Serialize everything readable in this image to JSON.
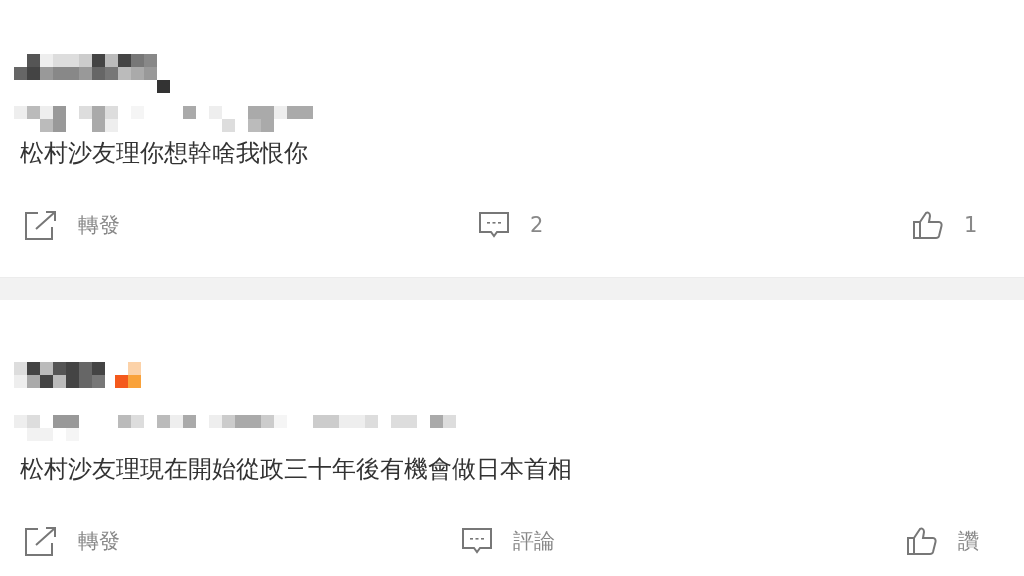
{
  "posts": [
    {
      "has_badge": false,
      "text": "松村沙友理你想幹啥我恨你",
      "actions": [
        {
          "kind": "share",
          "label": "轉發"
        },
        {
          "kind": "comment",
          "label": "2"
        },
        {
          "kind": "like",
          "label": "1"
        }
      ]
    },
    {
      "has_badge": true,
      "text": "松村沙友理現在開始從政三十年後有機會做日本首相",
      "actions": [
        {
          "kind": "share",
          "label": "轉發"
        },
        {
          "kind": "comment",
          "label": "評論"
        },
        {
          "kind": "like",
          "label": "讚"
        }
      ]
    }
  ]
}
